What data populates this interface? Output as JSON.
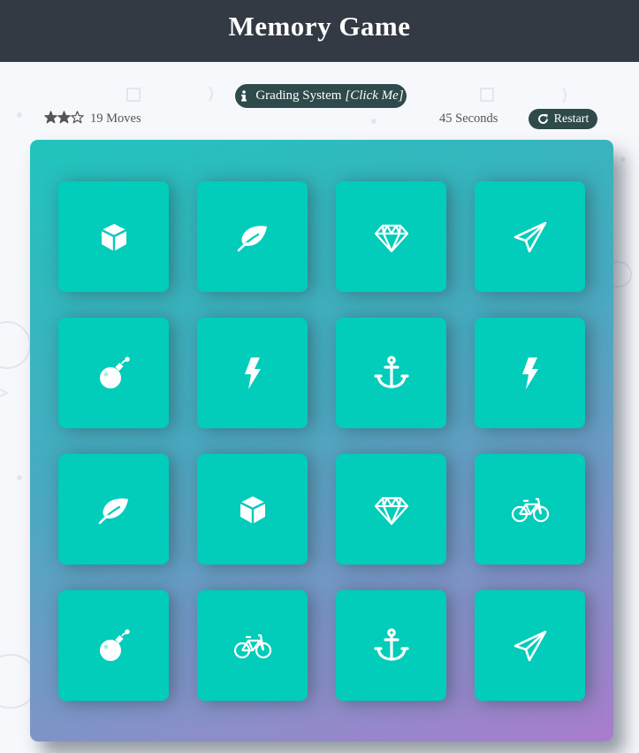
{
  "header": {
    "title": "Memory Game"
  },
  "grading": {
    "label": "Grading System",
    "cta": "[Click Me]",
    "icon": "info-icon"
  },
  "score": {
    "stars_filled": 2,
    "stars_total": 3,
    "moves_text": "19 Moves",
    "timer_text": "45 Seconds",
    "restart_label": "Restart",
    "star_color": "#555555"
  },
  "colors": {
    "header_bg": "#343a43",
    "card_bg": "#02ccba",
    "button_bg": "#2f4a4a"
  },
  "deck": {
    "rows": [
      [
        "cube-icon",
        "leaf-icon",
        "diamond-icon",
        "paper-plane-icon"
      ],
      [
        "bomb-icon",
        "bolt-icon",
        "anchor-icon",
        "bolt-icon"
      ],
      [
        "leaf-icon",
        "cube-icon",
        "diamond-icon",
        "bicycle-icon"
      ],
      [
        "bomb-icon",
        "bicycle-icon",
        "anchor-icon",
        "paper-plane-icon"
      ]
    ]
  }
}
